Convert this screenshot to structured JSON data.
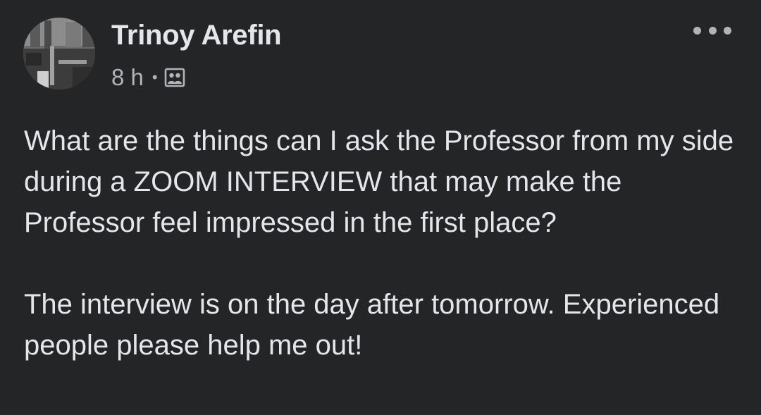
{
  "post": {
    "author": "Trinoy Arefin",
    "time": "8 h",
    "separator": "•",
    "audience_icon": "group-icon",
    "more_icon": "more-options-icon",
    "paragraphs": [
      "What are the things can I ask the Professor from my side during a ZOOM INTERVIEW that may make the Professor feel impressed in the first place?",
      "The interview is on the day after tomorrow. Experienced people please help me out!"
    ]
  },
  "colors": {
    "background": "#242526",
    "primary_text": "#e4e6eb",
    "secondary_text": "#b0b3b8"
  }
}
